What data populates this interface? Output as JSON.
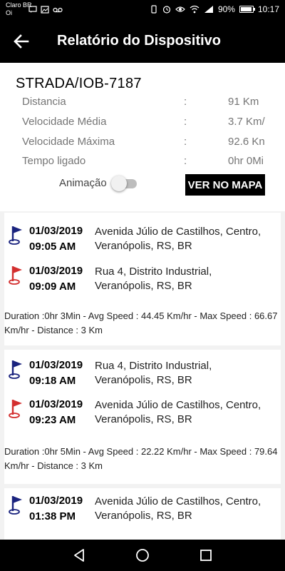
{
  "status_bar": {
    "carrier_line1": "Claro BR",
    "carrier_line2": "Oi",
    "battery_percent": "90%",
    "time": "10:17",
    "icons": [
      "sms-icon",
      "photo-icon",
      "voicemail-icon",
      "vibrate-icon",
      "alarm-icon",
      "eye-icon",
      "wifi-icon",
      "signal-icon",
      "battery-icon"
    ]
  },
  "app_bar": {
    "title": "Relatório do Dispositivo",
    "back_icon": "arrow-left-icon"
  },
  "summary": {
    "device": "STRADA/IOB-7187",
    "stats": [
      {
        "label": "Distancia",
        "sep": ":",
        "value": "91 Km"
      },
      {
        "label": "Velocidade Média",
        "sep": ":",
        "value": "3.7 Km/"
      },
      {
        "label": "Velocidade Máxima",
        "sep": ":",
        "value": "92.6 Kn"
      },
      {
        "label": "Tempo ligado",
        "sep": ":",
        "value": "0hr 0Mi"
      }
    ],
    "animation_label": "Animação",
    "animation_on": false,
    "map_button": "VER NO MAPA"
  },
  "trips": [
    {
      "start": {
        "date": "01/03/2019",
        "time": "09:05 AM",
        "address": "Avenida Júlio de Castilhos, Centro, Veranópolis, RS, BR"
      },
      "end": {
        "date": "01/03/2019",
        "time": "09:09 AM",
        "address": "Rua 4, Distrito Industrial, Veranópolis, RS, BR"
      },
      "summary": "Duration :0hr 3Min - Avg Speed : 44.45 Km/hr - Max Speed : 66.67 Km/hr - Distance : 3 Km"
    },
    {
      "start": {
        "date": "01/03/2019",
        "time": "09:18 AM",
        "address": "Rua 4, Distrito Industrial, Veranópolis, RS, BR"
      },
      "end": {
        "date": "01/03/2019",
        "time": "09:23 AM",
        "address": "Avenida Júlio de Castilhos, Centro, Veranópolis, RS, BR"
      },
      "summary": "Duration :0hr 5Min - Avg Speed : 22.22 Km/hr - Max Speed : 79.64 Km/hr - Distance : 3 Km"
    },
    {
      "start": {
        "date": "01/03/2019",
        "time": "01:38 PM",
        "address": "Avenida Júlio de Castilhos, Centro, Veranópolis, RS, BR"
      }
    }
  ],
  "colors": {
    "start_flag": "#1a237e",
    "end_flag": "#d32f2f",
    "bars": "#000000",
    "list_background": "#f2f2f2"
  },
  "nav_bar": {
    "icons": [
      "back-triangle-icon",
      "home-circle-icon",
      "recents-square-icon"
    ]
  }
}
